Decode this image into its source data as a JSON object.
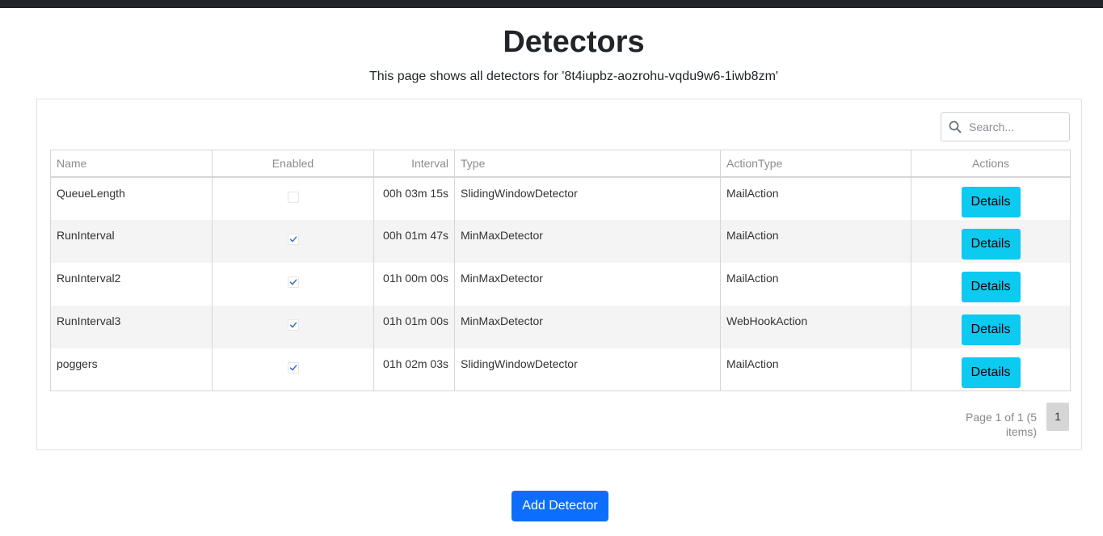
{
  "page": {
    "title": "Detectors",
    "subtitle": "This page shows all detectors for '8t4iupbz-aozrohu-vqdu9w6-1iwb8zm'"
  },
  "search": {
    "placeholder": "Search...",
    "value": "",
    "icon": "search-icon"
  },
  "table": {
    "columns": [
      "Name",
      "Enabled",
      "Interval",
      "Type",
      "ActionType",
      "Actions"
    ],
    "rows": [
      {
        "name": "QueueLength",
        "enabled": false,
        "interval": "00h 03m 15s",
        "type": "SlidingWindowDetector",
        "action_type": "MailAction",
        "action_label": "Details"
      },
      {
        "name": "RunInterval",
        "enabled": true,
        "interval": "00h 01m 47s",
        "type": "MinMaxDetector",
        "action_type": "MailAction",
        "action_label": "Details"
      },
      {
        "name": "RunInterval2",
        "enabled": true,
        "interval": "01h 00m 00s",
        "type": "MinMaxDetector",
        "action_type": "MailAction",
        "action_label": "Details"
      },
      {
        "name": "RunInterval3",
        "enabled": true,
        "interval": "01h 01m 00s",
        "type": "MinMaxDetector",
        "action_type": "WebHookAction",
        "action_label": "Details"
      },
      {
        "name": "poggers",
        "enabled": true,
        "interval": "01h 02m 03s",
        "type": "SlidingWindowDetector",
        "action_type": "MailAction",
        "action_label": "Details"
      }
    ]
  },
  "pager": {
    "info": "Page 1 of 1 (5 items)",
    "current_page": "1"
  },
  "footer": {
    "add_button_label": "Add Detector"
  },
  "colors": {
    "topbar": "#212529",
    "details_button": "#0dcaf0",
    "add_button": "#0d6efd",
    "checkmark": "#3b6fb6"
  }
}
